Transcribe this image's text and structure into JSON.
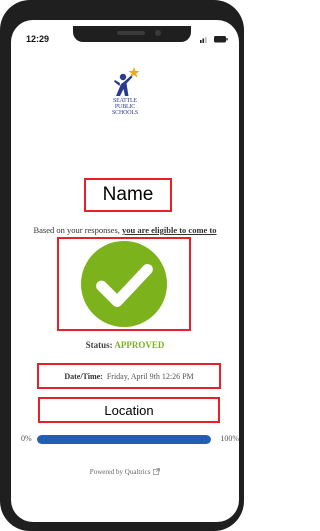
{
  "statusbar": {
    "time": "12:29",
    "icons": [
      "cellular-signal-icon",
      "battery-icon"
    ]
  },
  "logo": {
    "line1": "SEATTLE",
    "line2": "PUBLIC",
    "line3": "SCHOOLS"
  },
  "name_label": "Name",
  "message": {
    "prefix": "Based on your responses,",
    "emphasis": "you are eligible to come to school today."
  },
  "status": {
    "label": "Status:",
    "value": "APPROVED",
    "color": "#7cb31c"
  },
  "datetime": {
    "label": "Date/Time:",
    "value": "Friday, April 9th 12:26 PM"
  },
  "location_label": "Location",
  "progress": {
    "left_label": "0%",
    "right_label": "100%",
    "value_percent": 100
  },
  "footer": {
    "powered_by": "Powered by Qualtrics",
    "icon": "external-link-icon"
  },
  "colors": {
    "highlight_border": "#e8202a",
    "check_green": "#7cb31c",
    "progress_fill": "#1f5fb4"
  }
}
